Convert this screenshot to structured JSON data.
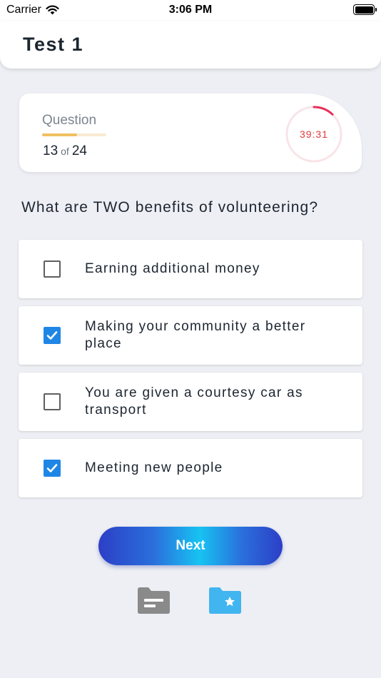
{
  "status_bar": {
    "carrier": "Carrier",
    "time": "3:06 PM"
  },
  "header": {
    "title": "Test 1"
  },
  "question_card": {
    "label": "Question",
    "current": "13",
    "of": "of",
    "total": "24",
    "progress": 0.54,
    "timer": "39:31",
    "timer_remaining_fraction": 0.12
  },
  "question": "What are TWO benefits of volunteering?",
  "options": [
    {
      "label": "Earning additional money",
      "checked": false
    },
    {
      "label": "Making your community a better place",
      "checked": true
    },
    {
      "label": "You are given a courtesy car as transport",
      "checked": false
    },
    {
      "label": "Meeting new people",
      "checked": true
    }
  ],
  "next_button": {
    "label": "Next"
  },
  "icons": {
    "notes": "folder-notes-icon",
    "favorites": "folder-star-icon"
  },
  "colors": {
    "accent": "#1f86e6",
    "timer": "#e23a3a",
    "progress": "#f0c060",
    "favorites_icon": "#41b5ef",
    "notes_icon": "#8a8a8a"
  }
}
